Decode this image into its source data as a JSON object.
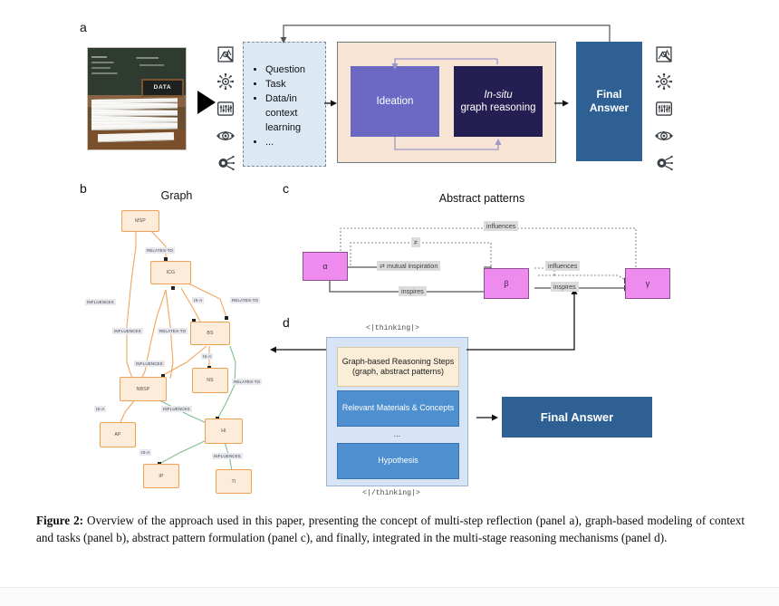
{
  "figure": {
    "caption_label": "Figure 2:",
    "caption_text": " Overview of the approach used in this paper, presenting the concept of multi-step reflection (panel a), graph-based modeling of context and tasks (panel b), abstract pattern formulation (panel c), and finally, integrated in the multi-stage reasoning mechanisms (panel d)."
  },
  "panel_a": {
    "letter": "a",
    "photo_sign_text": "DATA",
    "input_bullets": [
      "Question",
      "Task",
      "Data/in context learning",
      "..."
    ],
    "ideation_label": "Ideation",
    "insitu_italic": "In-situ",
    "insitu_rest": "graph reasoning",
    "final_answer_line1": "Final",
    "final_answer_line2": "Answer",
    "icons_left": [
      "document-analysis-icon",
      "network-hub-icon",
      "data-panel-icon",
      "molecule-icon",
      "microscope-icon"
    ],
    "icons_right": [
      "document-analysis-icon",
      "network-hub-icon",
      "data-panel-icon",
      "molecule-icon",
      "microscope-icon"
    ]
  },
  "panel_b": {
    "letter": "b",
    "title": "Graph",
    "nodes": [
      {
        "id": "MSP",
        "label": "MSP"
      },
      {
        "id": "ICG",
        "label": "ICG"
      },
      {
        "id": "BS",
        "label": "BS"
      },
      {
        "id": "NS",
        "label": "NS"
      },
      {
        "id": "NBSP",
        "label": "NBSP"
      },
      {
        "id": "AP",
        "label": "AP"
      },
      {
        "id": "HI",
        "label": "HI"
      },
      {
        "id": "IP",
        "label": "IP"
      },
      {
        "id": "TI",
        "label": "TI"
      }
    ],
    "edge_labels": [
      "RELATES-TO",
      "INFLUENCES",
      "INFLUENCES",
      "RELATES-TO",
      "IS-A",
      "RELATES-TO",
      "INFLUENCES",
      "IS-A",
      "RELATES-TO",
      "IS-A",
      "INFLUENCES",
      "IS-A",
      "INFLUENCES"
    ],
    "edge_colors": {
      "orange": "#f0a55c",
      "green": "#7fbf8f"
    }
  },
  "panel_c": {
    "letter": "c",
    "title": "Abstract patterns",
    "nodes": [
      {
        "id": "alpha",
        "label": "α"
      },
      {
        "id": "beta",
        "label": "β"
      },
      {
        "id": "gamma",
        "label": "γ"
      }
    ],
    "edge_labels": {
      "top_influences": "influences",
      "neq": "≠",
      "mutual": "⇄ mutual inspiration",
      "inspires_ab": "inspires",
      "influences_bg": "influences",
      "inspires_bg": "inspires"
    },
    "node_color": "#ef8bef"
  },
  "panel_d": {
    "letter": "d",
    "open_tag": "<|thinking|>",
    "close_tag": "<|/thinking|>",
    "steps": [
      {
        "text": "Graph-based Reasoning Steps (graph, abstract patterns)",
        "style": "cream"
      },
      {
        "text": "Relevant Materials & Concepts",
        "style": "blue"
      },
      {
        "text": "...",
        "style": "dots"
      },
      {
        "text": "Hypothesis",
        "style": "blue"
      }
    ],
    "final_answer": "Final Answer"
  }
}
